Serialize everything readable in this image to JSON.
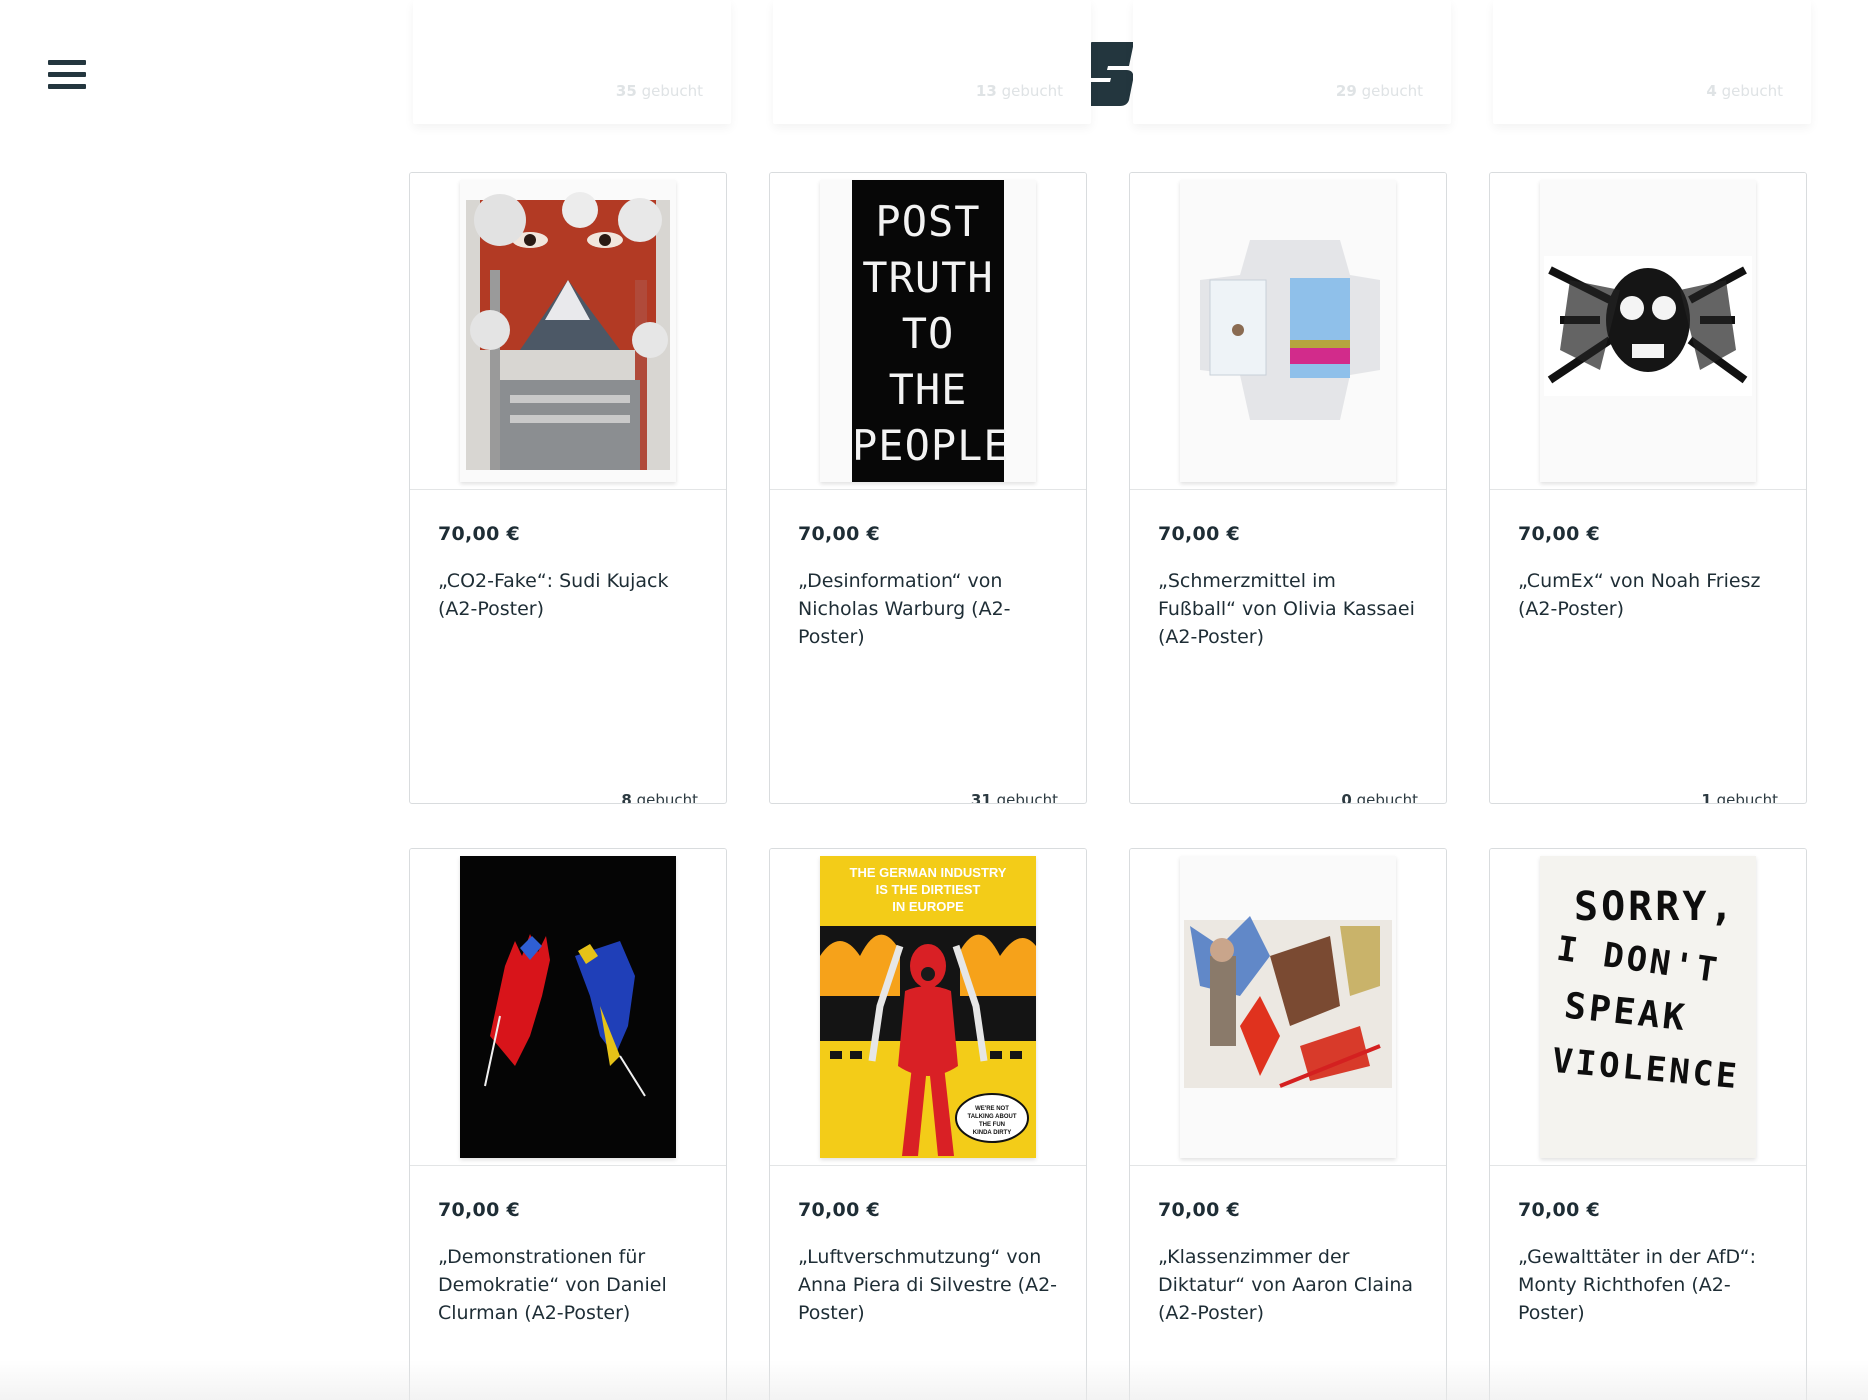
{
  "header": {
    "menu_icon": "hamburger-icon",
    "logo_icon": "s-logo-icon",
    "brand_color": "#23363e"
  },
  "top_row": [
    {
      "count": "35",
      "label": "gebucht"
    },
    {
      "count": "13",
      "label": "gebucht"
    },
    {
      "count": "29",
      "label": "gebucht"
    },
    {
      "count": "4",
      "label": "gebucht"
    }
  ],
  "products": [
    {
      "price": "70,00 €",
      "title": "„CO2-Fake“: Sudi Kujack (A2-Poster)",
      "count": "8",
      "label": "gebucht"
    },
    {
      "price": "70,00 €",
      "title": "„Desinformation“ von Nicholas Warburg (A2-Poster)",
      "count": "31",
      "label": "gebucht",
      "poster_text": [
        "POST",
        "TRUTH",
        "TO",
        "THE",
        "PEOPLE"
      ]
    },
    {
      "price": "70,00 €",
      "title": "„Schmerzmittel im Fußball“ von Olivia Kassaei (A2-Poster)",
      "count": "0",
      "label": "gebucht"
    },
    {
      "price": "70,00 €",
      "title": "„CumEx“ von Noah Friesz (A2-Poster)",
      "count": "1",
      "label": "gebucht"
    },
    {
      "price": "70,00 €",
      "title": "„Demonstrationen für Demokratie“ von Daniel Clurman (A2-Poster)"
    },
    {
      "price": "70,00 €",
      "title": "„Luftverschmutzung“ von Anna Piera di Silvestre (A2-Poster)",
      "poster_text": [
        "THE GERMAN INDUSTRY",
        "IS THE DIRTIEST",
        "IN EUROPE"
      ],
      "bubble_text": [
        "WE'RE NOT",
        "TALKING ABOUT",
        "THE FUN",
        "KINDA DIRTY"
      ]
    },
    {
      "price": "70,00 €",
      "title": "„Klassenzimmer der Diktatur“ von Aaron Claina (A2-Poster)"
    },
    {
      "price": "70,00 €",
      "title": "„Gewalttäter in der AfD“: Monty Richthofen (A2-Poster)",
      "poster_text": [
        "SORRY,",
        "I DON'T",
        "SPEAK",
        "VIOLENCE"
      ]
    }
  ]
}
